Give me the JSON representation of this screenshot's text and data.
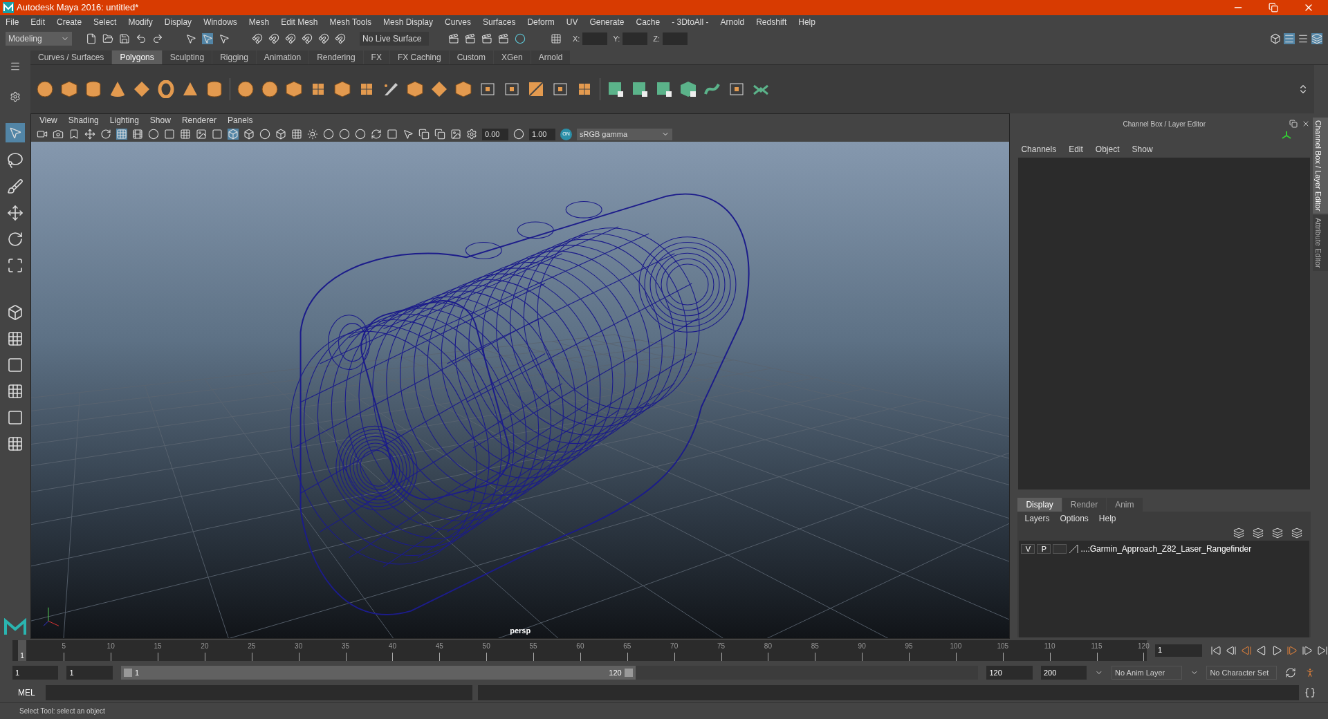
{
  "window": {
    "title": "Autodesk Maya 2016: untitled*"
  },
  "menu_bar": [
    "File",
    "Edit",
    "Create",
    "Select",
    "Modify",
    "Display",
    "Windows",
    "Mesh",
    "Edit Mesh",
    "Mesh Tools",
    "Mesh Display",
    "Curves",
    "Surfaces",
    "Deform",
    "UV",
    "Generate",
    "Cache",
    "- 3DtoAll -",
    "Arnold",
    "Redshift",
    "Help"
  ],
  "status_line": {
    "mode": "Modeling",
    "live_surface": "No Live Surface",
    "coords": [
      "X:",
      "Y:",
      "Z:"
    ]
  },
  "shelf_tabs": [
    {
      "label": "Curves / Surfaces",
      "selected": false
    },
    {
      "label": "Polygons",
      "selected": true
    },
    {
      "label": "Sculpting",
      "selected": false
    },
    {
      "label": "Rigging",
      "selected": false
    },
    {
      "label": "Animation",
      "selected": false
    },
    {
      "label": "Rendering",
      "selected": false
    },
    {
      "label": "FX",
      "selected": false
    },
    {
      "label": "FX Caching",
      "selected": false
    },
    {
      "label": "Custom",
      "selected": false
    },
    {
      "label": "XGen",
      "selected": false
    },
    {
      "label": "Arnold",
      "selected": false
    }
  ],
  "viewport": {
    "menus": [
      "View",
      "Shading",
      "Lighting",
      "Show",
      "Renderer",
      "Panels"
    ],
    "exposure": "0.00",
    "gamma": "1.00",
    "color_management": "ON",
    "color_space": "sRGB gamma",
    "camera": "persp"
  },
  "channel_box": {
    "title": "Channel Box / Layer Editor",
    "menus": [
      "Channels",
      "Edit",
      "Object",
      "Show"
    ]
  },
  "layer_editor": {
    "tabs": [
      {
        "label": "Display",
        "selected": true
      },
      {
        "label": "Render",
        "selected": false
      },
      {
        "label": "Anim",
        "selected": false
      }
    ],
    "menus": [
      "Layers",
      "Options",
      "Help"
    ],
    "layers": [
      {
        "visible": "V",
        "playback": "P",
        "name": "...:Garmin_Approach_Z82_Laser_Rangefinder"
      }
    ]
  },
  "side_tabs": [
    {
      "label": "Channel Box / Layer Editor",
      "selected": true
    },
    {
      "label": "Attribute Editor",
      "selected": false
    }
  ],
  "time_slider": {
    "ticks": [
      "5",
      "10",
      "15",
      "20",
      "25",
      "30",
      "35",
      "40",
      "45",
      "50",
      "55",
      "60",
      "65",
      "70",
      "75",
      "80",
      "85",
      "90",
      "95",
      "100",
      "105",
      "110",
      "115",
      "120"
    ],
    "current_frame": "1",
    "level": 0,
    "frame_field": "1"
  },
  "range_slider": {
    "start_time": "1",
    "playback_start": "1",
    "range_start": "1",
    "range_end": "120",
    "level": 0.6,
    "playback_end": "120",
    "end_time": "200",
    "anim_layer": "No Anim Layer",
    "character_set": "No Character Set"
  },
  "command_line": {
    "label": "MEL"
  },
  "help_line": "Select Tool: select an object"
}
